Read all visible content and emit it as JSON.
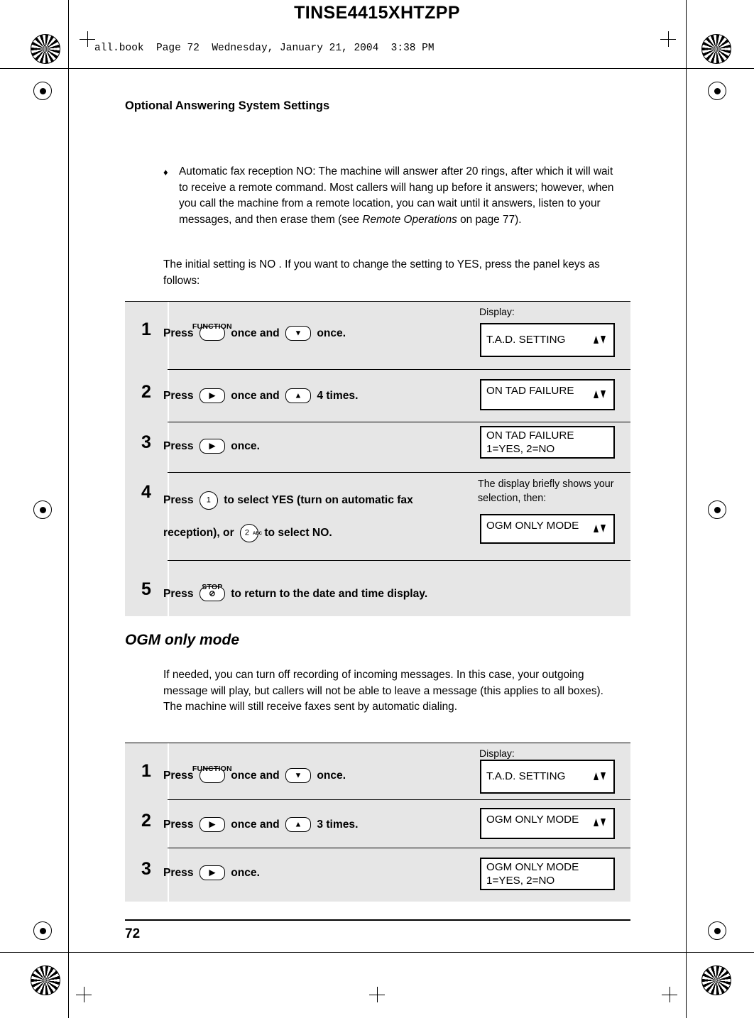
{
  "header": {
    "tinse_code": "TINSE4415XHTZPP",
    "book_line": "all.book  Page 72  Wednesday, January 21, 2004  3:38 PM"
  },
  "running_head": "Optional Answering System Settings",
  "page_number": "72",
  "bullet": {
    "marker": "♦",
    "text_before_italic": " Automatic fax reception NO: The machine will answer after 20 rings, after which it will wait to receive a remote command. Most callers will hang up before it answers; however, when you call the machine from a remote location, you can wait until it answers, listen to your messages, and then erase them (see ",
    "italic": "Remote Operations",
    "text_after_italic": " on page 77)."
  },
  "paragraph_intro": "The initial setting is NO . If you want to change the setting to YES, press the panel keys as follows:",
  "section": {
    "title": "OGM only mode",
    "body": "If needed, you can turn off recording of incoming messages. In this case, your outgoing message will play, but callers will not be able to leave a message (this applies to all boxes). The machine will still receive faxes sent by automatic dialing."
  },
  "table1": {
    "display_label": "Display:",
    "note": "The display briefly shows your selection, then:",
    "steps": [
      {
        "num": "1",
        "text_1": "Press",
        "key1_label": "FUNCTION",
        "key1_glyph": "",
        "text_2": "once and",
        "key2_glyph": "▼",
        "text_3": "once.",
        "lcd_line1": "T.A.D. SETTING",
        "lcd_arrows": true
      },
      {
        "num": "2",
        "text_1": "Press",
        "key1_glyph": "▶",
        "text_2": "once and",
        "key2_glyph": "▲",
        "text_3": "4 times.",
        "lcd_line1": "ON TAD FAILURE",
        "lcd_arrows": true
      },
      {
        "num": "3",
        "text_1": "Press",
        "key1_glyph": "▶",
        "text_2": "once.",
        "lcd_line1": "ON TAD FAILURE",
        "lcd_line2": "1=YES, 2=NO",
        "lcd_arrows": false
      },
      {
        "num": "4",
        "text_1": "Press",
        "key_digit_1": "1",
        "text_2": "to select YES (turn on automatic fax reception), or",
        "key_digit_2": "2",
        "key_digit_2_sub": "ABC",
        "text_3": "to select NO.",
        "lcd_line1": "OGM ONLY MODE",
        "lcd_arrows": true
      },
      {
        "num": "5",
        "text_1": "Press",
        "key1_label": "STOP",
        "key1_glyph": "⊘",
        "text_2": "to return to the date and time display."
      }
    ]
  },
  "table2": {
    "display_label": "Display:",
    "steps": [
      {
        "num": "1",
        "text_1": "Press",
        "key1_label": "FUNCTION",
        "text_2": "once and",
        "key2_glyph": "▼",
        "text_3": "once.",
        "lcd_line1": "T.A.D. SETTING",
        "lcd_arrows": true
      },
      {
        "num": "2",
        "text_1": "Press",
        "key1_glyph": "▶",
        "text_2": "once and",
        "key2_glyph": "▲",
        "text_3": "3 times.",
        "lcd_line1": "OGM ONLY MODE",
        "lcd_arrows": true
      },
      {
        "num": "3",
        "text_1": "Press",
        "key1_glyph": "▶",
        "text_2": "once.",
        "lcd_line1": "OGM ONLY MODE",
        "lcd_line2": "1=YES, 2=NO",
        "lcd_arrows": false
      }
    ]
  }
}
